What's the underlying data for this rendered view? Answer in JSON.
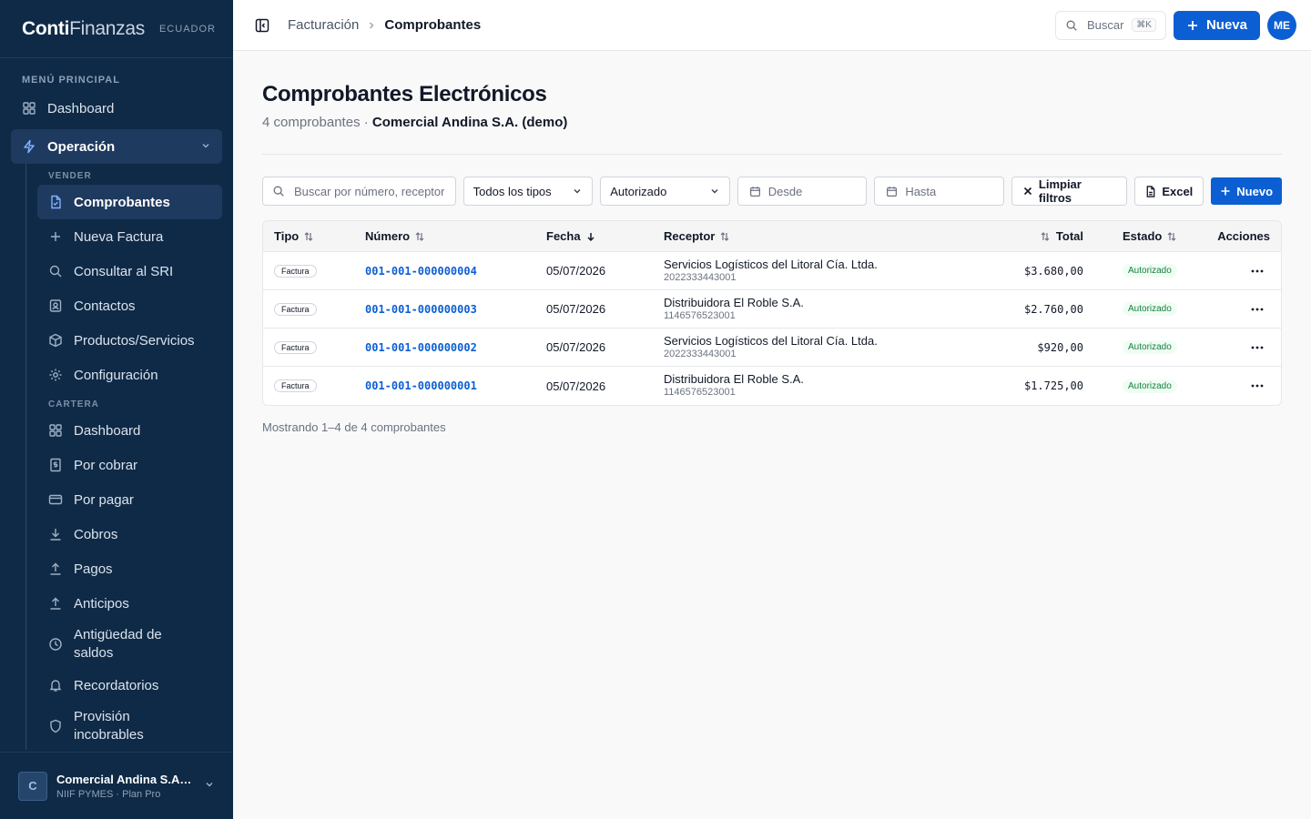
{
  "brand": {
    "name_bold": "Conti",
    "name_light": "Finanzas",
    "country": "ECUADOR"
  },
  "sidebar": {
    "section_main": "MENÚ PRINCIPAL",
    "dashboard": "Dashboard",
    "operacion": "Operación",
    "group_vender": "VENDER",
    "vender_items": [
      "Comprobantes",
      "Nueva Factura",
      "Consultar al SRI",
      "Contactos",
      "Productos/Servicios",
      "Configuración"
    ],
    "group_cartera": "CARTERA",
    "cartera_items": [
      "Dashboard",
      "Por cobrar",
      "Por pagar",
      "Cobros",
      "Pagos",
      "Anticipos",
      "Antigüedad de saldos",
      "Recordatorios",
      "Provisión incobrables"
    ],
    "workspace": {
      "initial": "C",
      "name": "Comercial Andina S.A. (demo)",
      "plan": "NIIF PYMES · Plan Pro"
    }
  },
  "topbar": {
    "breadcrumb_parent": "Facturación",
    "breadcrumb_current": "Comprobantes",
    "search_label": "Buscar",
    "search_shortcut": "⌘K",
    "new_button": "Nueva",
    "user_initials": "ME"
  },
  "page": {
    "title": "Comprobantes Electrónicos",
    "count_text": "4 comprobantes · ",
    "company": "Comercial Andina S.A. (demo)"
  },
  "filters": {
    "search_placeholder": "Buscar por número, receptor",
    "type_select": "Todos los tipos",
    "status_select": "Autorizado",
    "from_placeholder": "Desde",
    "to_placeholder": "Hasta",
    "clear": "Limpiar filtros",
    "excel": "Excel",
    "new": "Nuevo"
  },
  "table": {
    "headers": {
      "tipo": "Tipo",
      "numero": "Número",
      "fecha": "Fecha",
      "receptor": "Receptor",
      "total": "Total",
      "estado": "Estado",
      "acciones": "Acciones"
    },
    "rows": [
      {
        "tipo": "Factura",
        "numero": "001-001-000000004",
        "fecha": "05/07/2026",
        "receptor": "Servicios Logísticos del Litoral Cía. Ltda.",
        "ruc": "2022333443001",
        "total": "$3.680,00",
        "estado": "Autorizado"
      },
      {
        "tipo": "Factura",
        "numero": "001-001-000000003",
        "fecha": "05/07/2026",
        "receptor": "Distribuidora El Roble S.A.",
        "ruc": "1146576523001",
        "total": "$2.760,00",
        "estado": "Autorizado"
      },
      {
        "tipo": "Factura",
        "numero": "001-001-000000002",
        "fecha": "05/07/2026",
        "receptor": "Servicios Logísticos del Litoral Cía. Ltda.",
        "ruc": "2022333443001",
        "total": "$920,00",
        "estado": "Autorizado"
      },
      {
        "tipo": "Factura",
        "numero": "001-001-000000001",
        "fecha": "05/07/2026",
        "receptor": "Distribuidora El Roble S.A.",
        "ruc": "1146576523001",
        "total": "$1.725,00",
        "estado": "Autorizado"
      }
    ],
    "footer": "Mostrando 1–4 de 4 comprobantes"
  },
  "colors": {
    "sidebar_bg": "#0f2a47",
    "accent": "#0b5fd3",
    "success": "#15803d"
  }
}
